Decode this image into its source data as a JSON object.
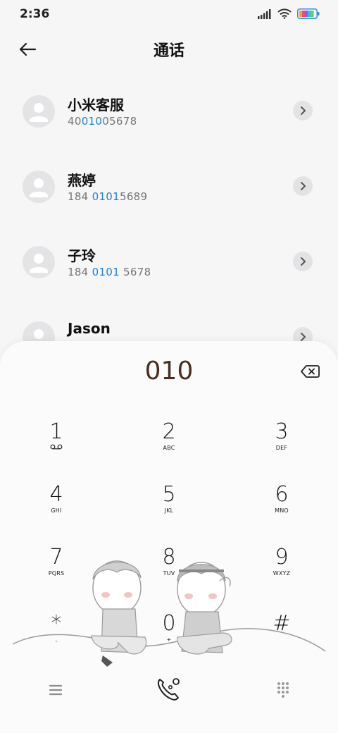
{
  "status": {
    "time": "2:36"
  },
  "header": {
    "title": "通话"
  },
  "contacts": [
    {
      "name": "小米客服",
      "num_pre": "40",
      "num_hl": "010",
      "num_post": "05678"
    },
    {
      "name": "燕婷",
      "num_pre": "184 ",
      "num_hl": "0101",
      "num_post": "5689"
    },
    {
      "name": "子玲",
      "num_pre": "184 ",
      "num_hl": "0101",
      "num_post": " 5678"
    },
    {
      "name": "Jason",
      "num_pre": "",
      "num_hl": "",
      "num_post": ""
    }
  ],
  "dialpad": {
    "entered": "010",
    "keys": [
      {
        "digit": "1",
        "letters": ""
      },
      {
        "digit": "2",
        "letters": "ABC"
      },
      {
        "digit": "3",
        "letters": "DEF"
      },
      {
        "digit": "4",
        "letters": "GHI"
      },
      {
        "digit": "5",
        "letters": "JKL"
      },
      {
        "digit": "6",
        "letters": "MNO"
      },
      {
        "digit": "7",
        "letters": "PQRS"
      },
      {
        "digit": "8",
        "letters": "TUV"
      },
      {
        "digit": "9",
        "letters": "WXYZ"
      },
      {
        "digit": "*",
        "letters": ","
      },
      {
        "digit": "0",
        "letters": "+"
      },
      {
        "digit": "#",
        "letters": ""
      }
    ]
  },
  "icons": {
    "back": "arrow-left-icon",
    "backspace": "backspace-icon",
    "menu": "menu-icon",
    "call": "phone-icon",
    "keypad": "dialpad-icon"
  },
  "colors": {
    "highlight": "#1a83d8",
    "entered": "#4a2e22"
  }
}
